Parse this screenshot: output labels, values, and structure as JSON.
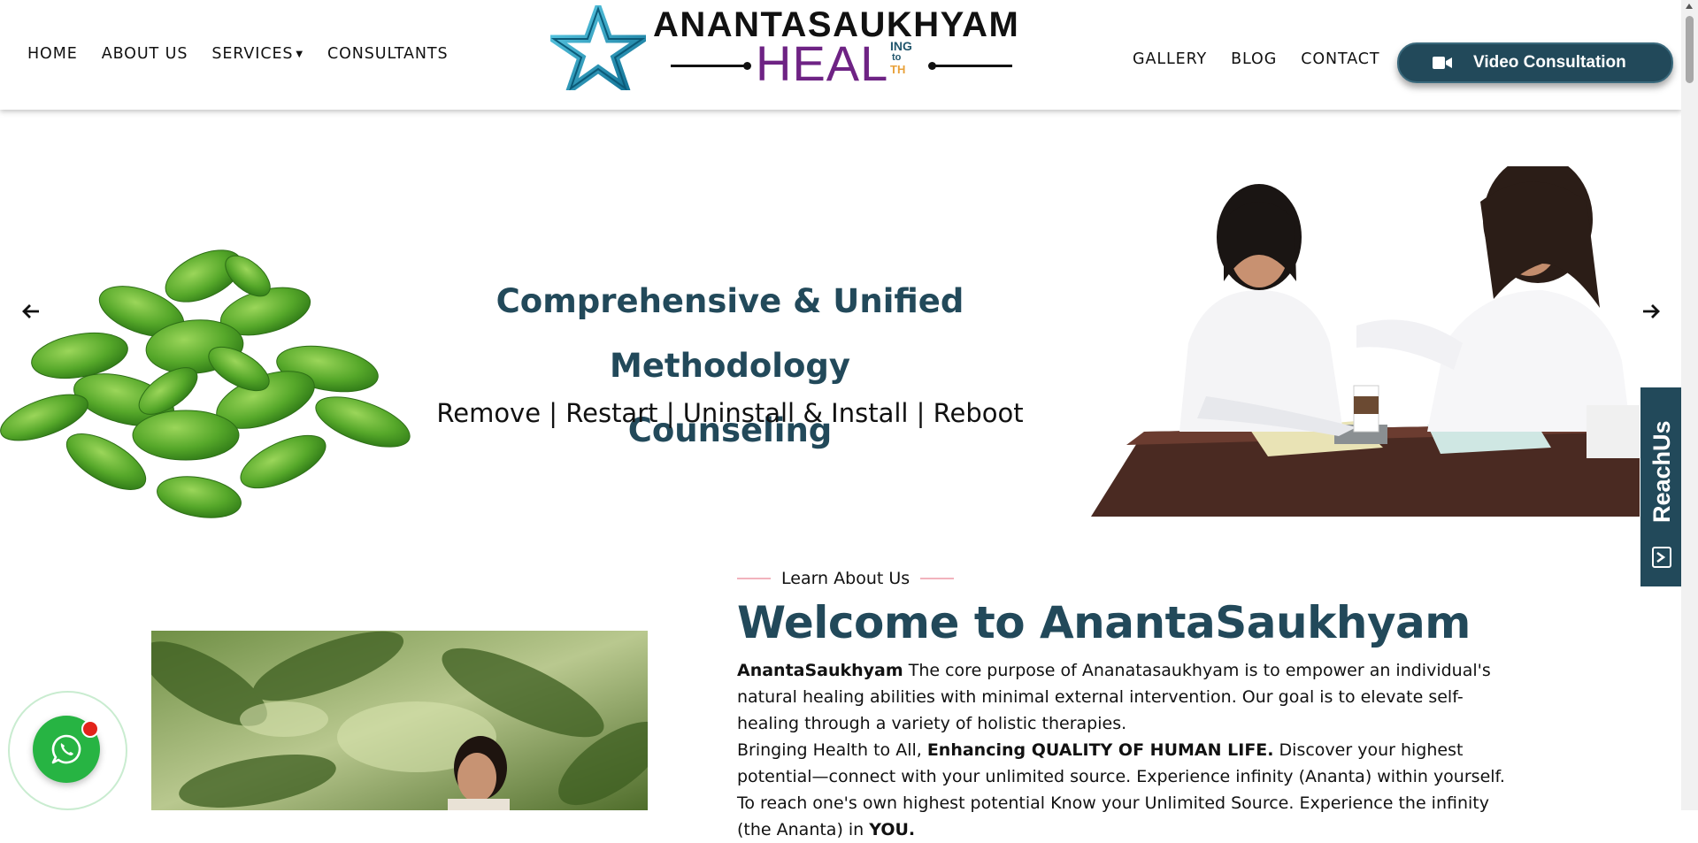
{
  "nav": {
    "left": [
      {
        "label": "HOME"
      },
      {
        "label": "ABOUT US"
      },
      {
        "label": "SERVICES",
        "has_dropdown": true
      },
      {
        "label": "CONSULTANTS"
      }
    ],
    "right": [
      {
        "label": "GALLERY"
      },
      {
        "label": "BLOG"
      },
      {
        "label": "CONTACT"
      }
    ],
    "cta": {
      "label": "Video Consultation",
      "icon": "video-camera-icon"
    }
  },
  "logo": {
    "top": "ANANTASAUKHYAM",
    "heal": "HEAL",
    "sup1": "ING",
    "sup2": "to",
    "sup3": "TH",
    "colors": {
      "star": "#1fa4c9",
      "heal": "#6e2384",
      "sup": "#21566d",
      "sup_th": "#e8a13a"
    }
  },
  "hero": {
    "title_line1": "Comprehensive & Unified Methodology",
    "title_line2": "Counseling",
    "subtitle": "Remove | Restart | Uninstall & Install | Reboot",
    "prev_icon": "arrow-left-icon",
    "next_icon": "arrow-right-icon"
  },
  "reach_us": {
    "label": "ReachUs",
    "icon": "exit-icon"
  },
  "about": {
    "eyebrow": "Learn About Us",
    "title": "Welcome to AnantaSaukhyam",
    "p1_bold": "AnantaSaukhyam",
    "p1_text": " The core purpose of Ananatasaukhyam is to empower an individual's natural healing abilities with minimal external intervention. Our goal is to elevate self-healing through a variety of holistic therapies.",
    "p2_text1": "Bringing Health to All, ",
    "p2_bold": "Enhancing QUALITY OF HUMAN LIFE.",
    "p2_text2": " Discover your highest potential—connect with your unlimited source. Experience infinity (Ananta) within yourself. To reach one's own highest potential Know your Unlimited Source. Experience the infinity (the Ananta) in ",
    "p2_bold2": "YOU."
  },
  "whatsapp": {
    "icon": "whatsapp-icon"
  },
  "colors": {
    "primary": "#22495a",
    "accent_pink": "#f2b3bd",
    "whatsapp": "#27b443"
  }
}
